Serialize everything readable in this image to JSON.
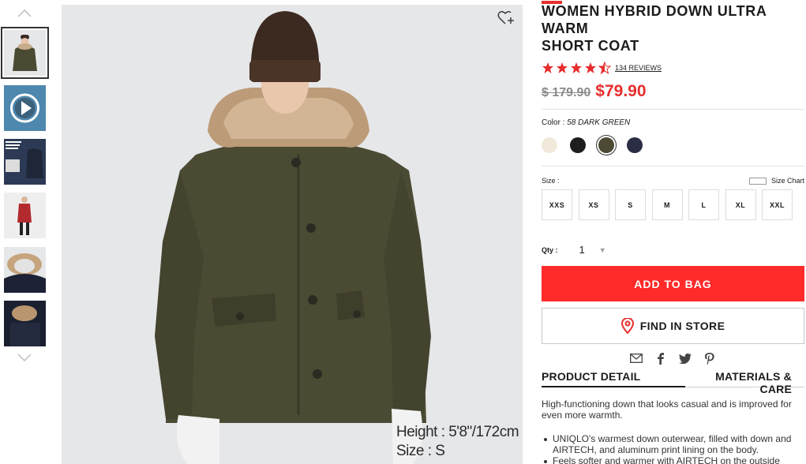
{
  "product": {
    "title_line1": "WOMEN HYBRID DOWN ULTRA WARM",
    "title_line2": "SHORT COAT",
    "rating": 4.5,
    "reviews_label": "134 REVIEWS",
    "old_price": "$ 179.90",
    "new_price": "$79.90"
  },
  "gallery": {
    "caption_height": "Height : 5'8\"/172cm",
    "caption_size": "Size : S"
  },
  "color": {
    "label": "Color :",
    "selected": "58 DARK GREEN",
    "swatches": [
      "#f1eadb",
      "#1e1e1e",
      "#4c4a34",
      "#2b2d45"
    ]
  },
  "size": {
    "label": "Size :",
    "chart_label": "Size Chart",
    "options": [
      "XXS",
      "XS",
      "S",
      "M",
      "L",
      "XL",
      "XXL"
    ]
  },
  "qty": {
    "label": "Qty :",
    "value": "1"
  },
  "actions": {
    "add_to_bag": "ADD TO BAG",
    "find_in_store": "FIND IN STORE"
  },
  "tabs": {
    "detail": "PRODUCT DETAIL",
    "materials": "MATERIALS & CARE"
  },
  "detail": {
    "description": "High-functioning down that looks casual and is improved for even more warmth.",
    "bullets": [
      "UNIQLO's warmest down outerwear, filled with down and AIRTECH, and aluminum print lining on the body.",
      "Feels softer and warmer with AIRTECH on the outside"
    ]
  },
  "colors": {
    "accent": "#e62e2e",
    "button": "#ff2a2a"
  }
}
